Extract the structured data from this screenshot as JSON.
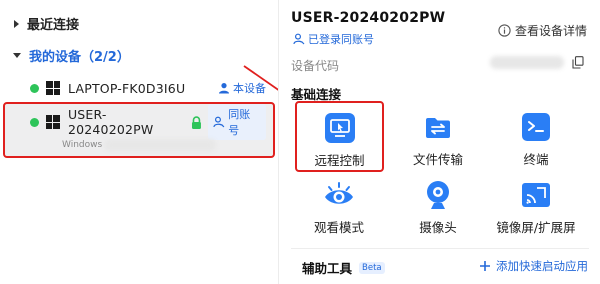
{
  "sidebar": {
    "recent_label": "最近连接",
    "my_devices_label": "我的设备（2/2）",
    "devices": [
      {
        "name": "LAPTOP-FK0D3I6U",
        "tag": "本设备"
      },
      {
        "name": "USER-20240202PW",
        "tag": "同账号",
        "os": "Windows"
      }
    ]
  },
  "detail": {
    "device_name": "USER-20240202PW",
    "logged_in_label": "已登录同账号",
    "view_details_label": "查看设备详情",
    "device_code_label": "设备代码"
  },
  "basic": {
    "section_title": "基础连接",
    "tiles": [
      {
        "label": "远程控制",
        "icon": "remote-control-icon"
      },
      {
        "label": "文件传输",
        "icon": "file-transfer-icon"
      },
      {
        "label": "终端",
        "icon": "terminal-icon"
      },
      {
        "label": "观看模式",
        "icon": "eye-icon"
      },
      {
        "label": "摄像头",
        "icon": "camera-icon"
      },
      {
        "label": "镜像屏/扩展屏",
        "icon": "cast-screen-icon"
      }
    ]
  },
  "aux": {
    "title": "辅助工具",
    "badge": "Beta",
    "add_label": "添加快速启动应用"
  },
  "colors": {
    "accent": "#2469d9",
    "highlight": "#e0201e",
    "online": "#2ec45a"
  }
}
